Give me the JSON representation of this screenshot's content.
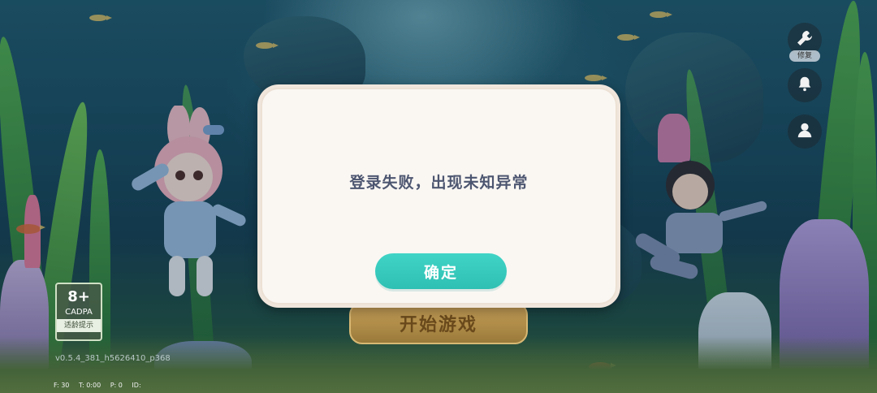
{
  "dialog": {
    "message": "登录失败，出现未知异常",
    "confirm_label": "确定"
  },
  "main": {
    "start_label": "开始游戏"
  },
  "side_buttons": {
    "repair_label": "修复",
    "repair_icon": "wrench-icon",
    "notice_icon": "bell-icon",
    "account_icon": "user-icon"
  },
  "age_rating": {
    "age": "8+",
    "org": "CADPA",
    "tip": "适龄提示"
  },
  "version": "v0.5.4_381_h5626410_p368",
  "debug": {
    "fps": "F: 30",
    "t": "T: 0:00",
    "p": "P: 0",
    "id": "ID:"
  },
  "colors": {
    "confirm": "#36c9bc",
    "dialog_bg": "#faf7f3",
    "message": "#4d5670",
    "start_button": "#b8924c"
  }
}
